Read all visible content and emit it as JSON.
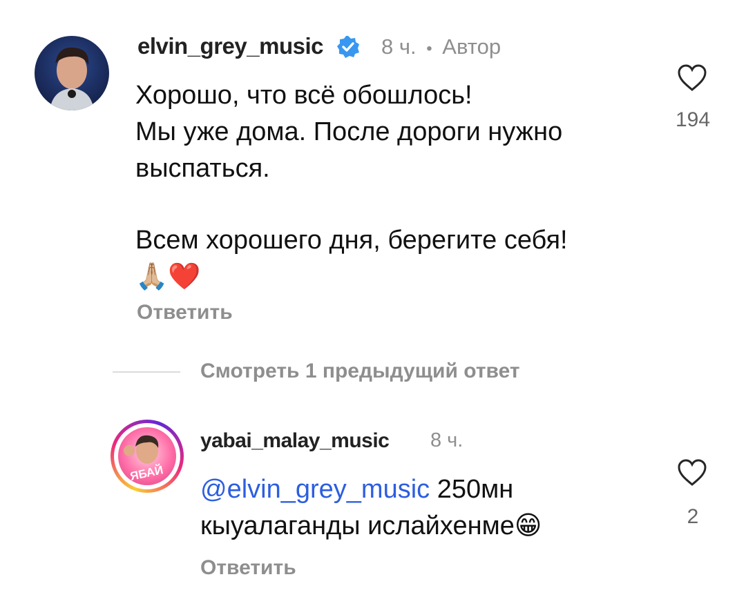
{
  "comment": {
    "username": "elvin_grey_music",
    "verified": true,
    "time": "8 ч.",
    "separator": "•",
    "author_badge": "Автор",
    "lines": [
      "Хорошо, что всё обошлось!",
      "Мы уже дома. После дороги нужно",
      "выспаться.",
      "",
      "Всем хорошего дня, берегите себя!"
    ],
    "emoji": [
      "🙏🏼",
      "❤️"
    ],
    "reply_label": "Ответить",
    "like_count": "194"
  },
  "view_previous": "Смотреть 1 предыдущий ответ",
  "reply": {
    "username": "yabai_malay_music",
    "time": "8 ч.",
    "avatar_text": "ЯБАЙ",
    "mention": "@elvin_grey_music",
    "line1_rest": " 250мн",
    "line2": "кыуалаганды ислайхенме",
    "emoji": "😁",
    "reply_label": "Ответить",
    "like_count": "2"
  },
  "colors": {
    "text": "#111111",
    "secondary": "#8e8e8e",
    "mention": "#2c5ee0",
    "verified": "#3897f0"
  }
}
